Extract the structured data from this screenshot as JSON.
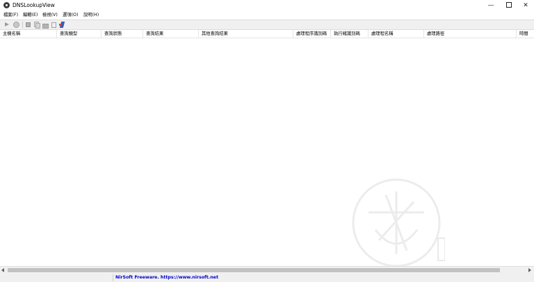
{
  "window": {
    "title": "DNSLookupView",
    "minimize": "—",
    "close": "✕"
  },
  "menu": [
    "檔案(F)",
    "編輯(E)",
    "檢視(V)",
    "選項(O)",
    "說明(H)"
  ],
  "columns": [
    "主機名稱",
    "查詢類型",
    "查詢狀態",
    "查詢結果",
    "其他查詢結果",
    "處理程序識別碼",
    "執行緒識別碼",
    "處理程名稱",
    "處理路徑",
    "時間"
  ],
  "status": {
    "link_text": "NirSoft Freeware. https://www.nirsoft.net",
    "link_color": "#0000cc"
  },
  "icons": [
    "app-icon",
    "play-icon",
    "stop-icon",
    "save-icon",
    "copy-icon",
    "properties-icon",
    "find-icon",
    "about-icon"
  ]
}
